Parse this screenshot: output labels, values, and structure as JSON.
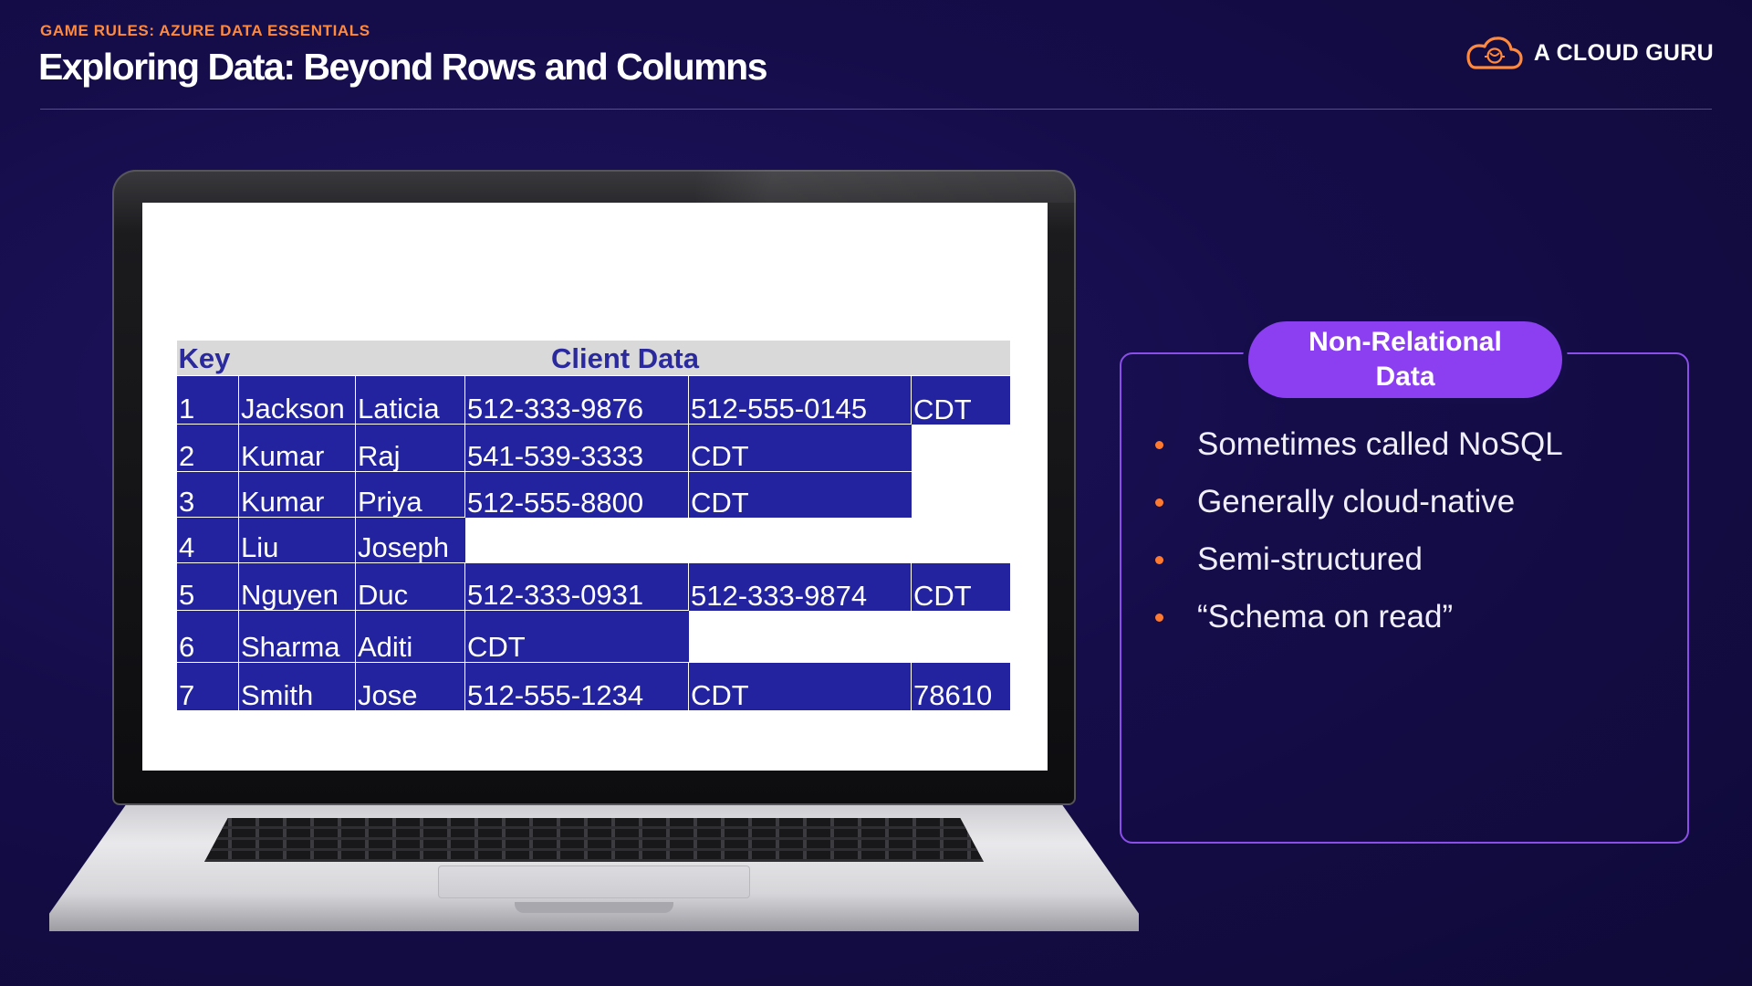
{
  "header": {
    "eyebrow": "GAME RULES: AZURE DATA ESSENTIALS",
    "title": "Exploring Data: Beyond Rows and Columns",
    "brand": "A CLOUD GURU"
  },
  "table": {
    "headers": {
      "key": "Key",
      "client": "Client Data"
    },
    "rows": [
      [
        "1",
        "Jackson",
        "Laticia",
        "512-333-9876",
        "512-555-0145",
        "CDT"
      ],
      [
        "2",
        "Kumar",
        "Raj",
        "541-539-3333",
        "CDT"
      ],
      [
        "3",
        "Kumar",
        "Priya",
        "512-555-8800",
        "CDT"
      ],
      [
        "4",
        "Liu",
        "Joseph"
      ],
      [
        "5",
        "Nguyen",
        "Duc",
        "512-333-0931",
        "512-333-9874",
        "CDT"
      ],
      [
        "6",
        "Sharma",
        "Aditi",
        "CDT"
      ],
      [
        "7",
        "Smith",
        "Jose",
        "512-555-1234",
        "CDT",
        "78610"
      ]
    ]
  },
  "panel": {
    "badge": "Non-Relational Data",
    "bullets": [
      "Sometimes called NoSQL",
      "Generally cloud-native",
      "Semi-structured",
      "“Schema on read”"
    ]
  },
  "colors": {
    "background": "#150d4a",
    "accent_orange": "#ff8a3d",
    "accent_purple": "#8b3ff0",
    "table_cell": "#2323a0",
    "table_header_bg": "#d9d9d9",
    "table_header_text": "#2a2a9e"
  },
  "icons": {
    "brand_logo": "cloud-logo-icon",
    "bullet": "bullet-dot-icon"
  }
}
